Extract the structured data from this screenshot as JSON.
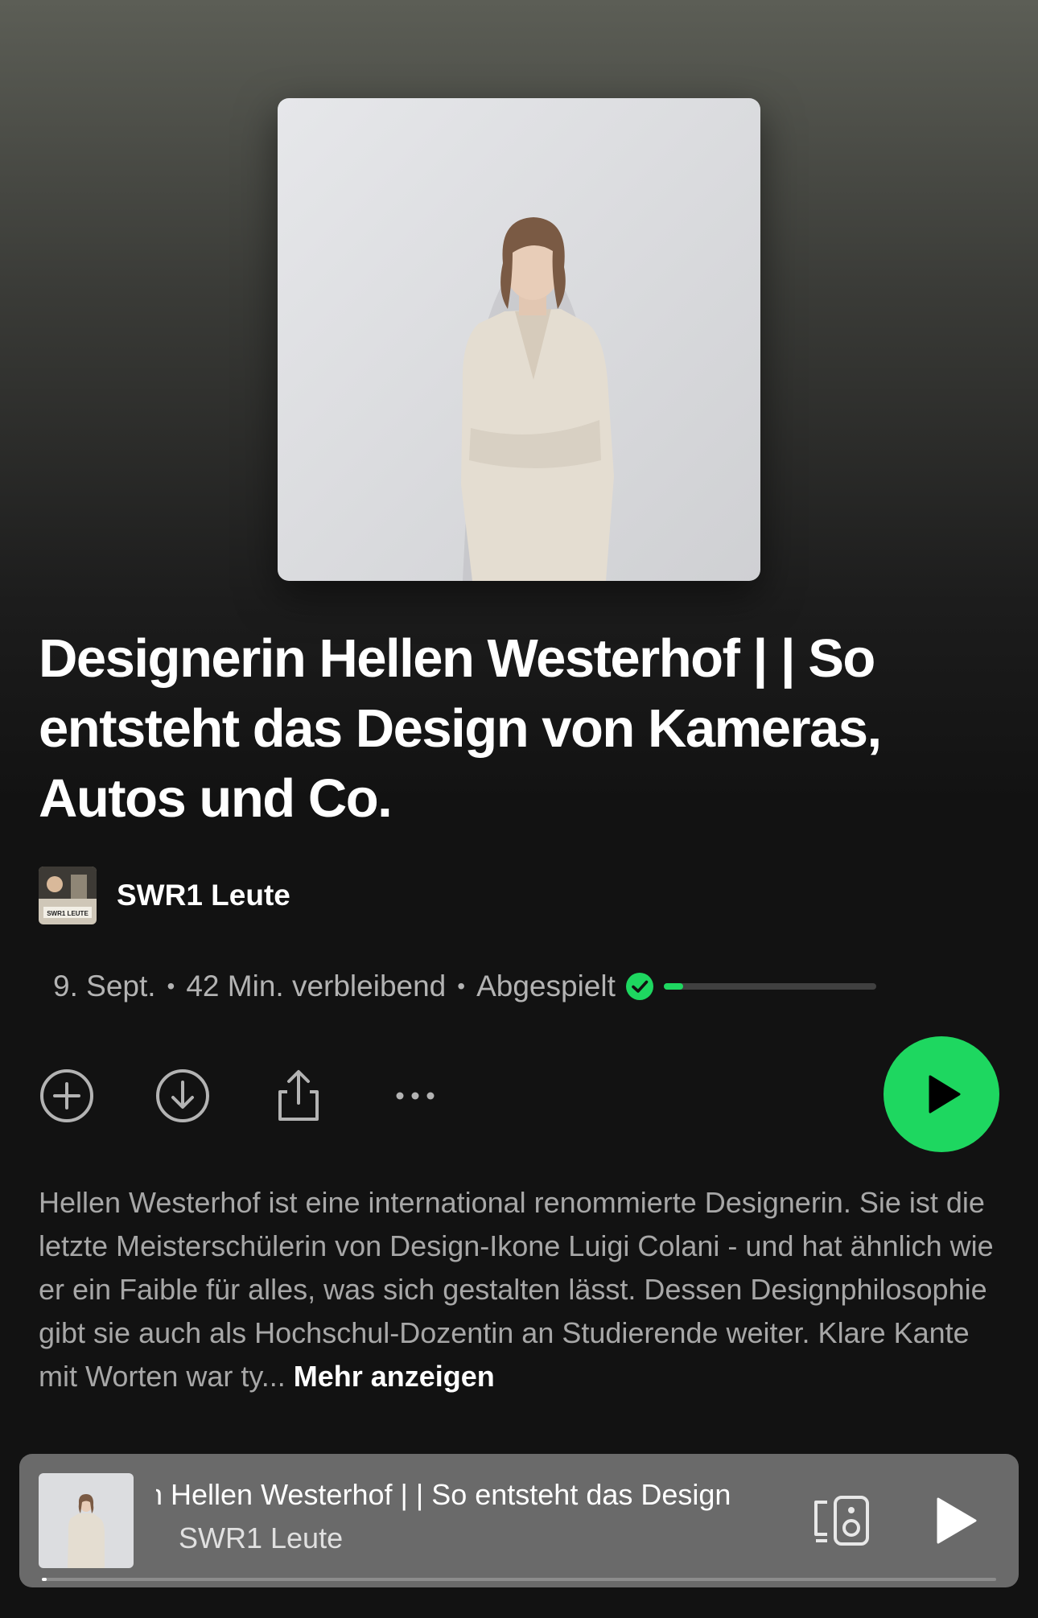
{
  "episode": {
    "title": "Designerin Hellen Westerhof | | So entsteht das Design von Kameras, Autos und Co.",
    "show_name": "SWR1 Leute",
    "show_thumb_label": "SWR1 LEUTE",
    "date": "9. Sept.",
    "remaining": "42 Min. verbleibend",
    "status": "Abgespielt",
    "progress_fraction": 0.09,
    "description": "Hellen Westerhof ist eine international renommierte Designerin. Sie ist die letzte Meisterschülerin von Design-Ikone Luigi Colani - und hat ähnlich wie er ein Faible für alles, was sich gestalten lässt. Dessen Designphilosophie gibt sie auch als Hochschul-Dozentin an Studierende weiter. Klare Kante mit Worten war ty...",
    "more_label": "Mehr anzeigen"
  },
  "actions": {
    "icons": [
      "add-circle-icon",
      "download-icon",
      "share-icon",
      "more-options-icon",
      "play-icon"
    ]
  },
  "mini_player": {
    "title": "in Hellen Westerhof | | So entsteht das Design",
    "subtitle": "SWR1 Leute",
    "progress_fraction": 0.005,
    "icons": [
      "connect-devices-icon",
      "play-icon"
    ]
  },
  "colors": {
    "accent": "#1ed760",
    "background": "#121212",
    "mini_player_bg": "#6a6a6a"
  }
}
